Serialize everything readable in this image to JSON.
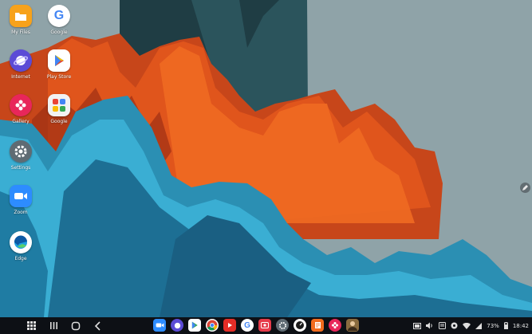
{
  "desktop": {
    "icons": [
      {
        "label": "My Files",
        "icon": "folder-icon",
        "color": "#f7a21b"
      },
      {
        "label": "Google",
        "icon": "google-icon",
        "color": "#ffffff"
      },
      {
        "label": "Internet",
        "icon": "internet-icon",
        "color": "#5b4bd6"
      },
      {
        "label": "Play Store",
        "icon": "play-store-icon",
        "color": "#ffffff"
      },
      {
        "label": "Gallery",
        "icon": "gallery-icon",
        "color": "#e8265a"
      },
      {
        "label": "Google",
        "icon": "google-apps-folder-icon",
        "color": "#f2f2f2"
      },
      {
        "label": "Settings",
        "icon": "settings-icon",
        "color": "#5f6b73"
      },
      {
        "label": "Zoom",
        "icon": "zoom-icon",
        "color": "#2d8cff"
      },
      {
        "label": "Edge",
        "icon": "edge-icon",
        "color": "#ffffff"
      }
    ]
  },
  "taskbar": {
    "nav": [
      "apps-grid-icon",
      "recents-icon",
      "home-icon",
      "back-icon"
    ],
    "dock": [
      {
        "icon": "zoom-icon",
        "color": "#2d8cff"
      },
      {
        "icon": "internet-icon",
        "color": "#5b4bd6"
      },
      {
        "icon": "play-store-icon",
        "color": "#ffffff"
      },
      {
        "icon": "chrome-icon",
        "color": "#ffffff"
      },
      {
        "icon": "youtube-icon",
        "color": "#e52d27"
      },
      {
        "icon": "google-icon",
        "color": "#ffffff"
      },
      {
        "icon": "screen-recorder-icon",
        "color": "#e63b4a"
      },
      {
        "icon": "settings-icon",
        "color": "#5f6b73"
      },
      {
        "icon": "clock-icon",
        "color": "#ffffff"
      },
      {
        "icon": "notes-icon",
        "color": "#f26b1d"
      },
      {
        "icon": "gallery-icon",
        "color": "#e8265a"
      },
      {
        "icon": "avatar-icon",
        "color": "#8a6b3f"
      }
    ],
    "tray": {
      "battery": "73%",
      "time": "18:42"
    }
  }
}
